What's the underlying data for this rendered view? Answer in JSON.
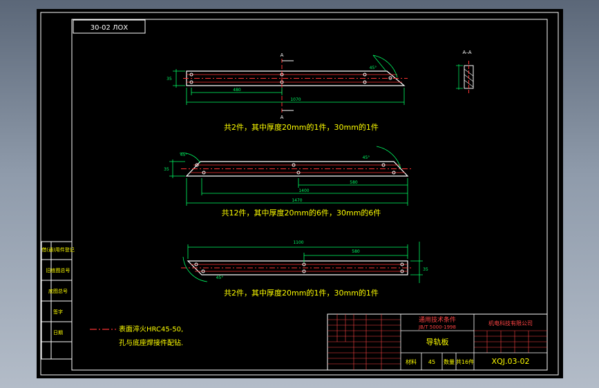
{
  "drawing": {
    "stamp": "30-02 ЛОХ",
    "section_label": "A",
    "section_pair": "A–A",
    "plates": [
      {
        "dims": {
          "width": "35",
          "hole_pitch": "480",
          "length": "1070",
          "angle": "45°"
        },
        "caption": "共2件，其中厚度20mm的1件，30mm的1件"
      },
      {
        "dims": {
          "width": "35",
          "right_dim": "580",
          "total": "1470",
          "inner": "1400",
          "angle_left": "45°",
          "angle_right": "45°"
        },
        "caption": "共12件，其中厚度20mm的6件，30mm的6件"
      },
      {
        "dims": {
          "width": "35",
          "top": "1100",
          "partial": "580",
          "angle": "45°"
        },
        "caption": "共2件，其中厚度20mm的1件，30mm的1件"
      }
    ],
    "notes": [
      "表面淬火HRC45-50,",
      "孔与底座焊接件配钻."
    ],
    "left_strip": [
      "借(通)用件登记",
      "旧底图总号",
      "底图总号",
      "签字",
      "日期"
    ],
    "title_block": {
      "standard_title": "通用技术条件",
      "standard_code": "JB/T 5000-1998",
      "part_name": "导轨板",
      "company": "机电科技有限公司",
      "material_label": "材料",
      "material": "45",
      "qty_label": "数量",
      "qty": "共16件",
      "drawing_no": "XQJ.03-02"
    }
  },
  "colors": {
    "frame": "#ffffff",
    "outline": "#ffffff",
    "center": "#ff3333",
    "dim": "#00ff66",
    "text": "#ffff00",
    "grid": "#ff4444",
    "paper": "#000000"
  }
}
